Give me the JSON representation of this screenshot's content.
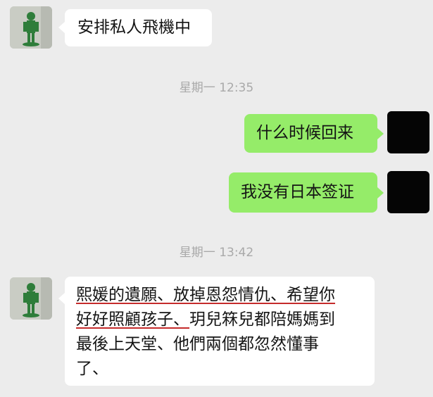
{
  "chat": {
    "messages": [
      {
        "side": "in",
        "text": "安排私人飛機中"
      },
      {
        "side": "out",
        "text": "什么时候回来"
      },
      {
        "side": "out",
        "text": "我没有日本签证"
      }
    ],
    "long_message": {
      "underlined_1": "熙媛的遺願、放掉恩怨情仇、希望你",
      "underlined_2": "好好照顧孩子、",
      "rest_2": "玥兒箖兒都陪媽媽到",
      "line_3": "最後上天堂、他們兩個都忽然懂事",
      "line_4": "了、"
    },
    "timestamps": [
      "星期一 12:35",
      "星期一 13:42"
    ]
  },
  "colors": {
    "background": "#ececec",
    "incoming_bubble": "#ffffff",
    "outgoing_bubble": "#95ec69",
    "timestamp": "#a9a9a9",
    "underline": "#c52b2b"
  }
}
